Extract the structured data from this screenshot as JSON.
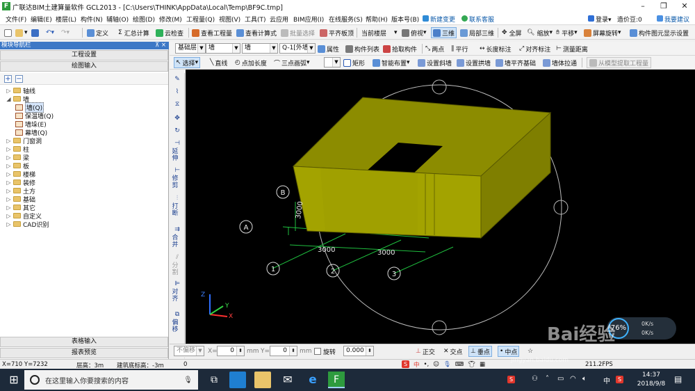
{
  "window": {
    "title": "广联达BIM土建算量软件 GCL2013 - [C:\\Users\\THINK\\AppData\\Local\\Temp\\BF9C.tmp]",
    "app_icon": "F",
    "btn_min": "–",
    "btn_max": "❐",
    "btn_close": "✕"
  },
  "menu": {
    "items": [
      "文件(F)",
      "编辑(E)",
      "楼层(L)",
      "构件(N)",
      "辅轴(O)",
      "绘图(D)",
      "修改(M)",
      "工程量(Q)",
      "视图(V)",
      "工具(T)",
      "云应用",
      "BIM应用(I)",
      "在线服务(S)",
      "帮助(H)",
      "版本号(B)",
      "新建变更",
      "联系客服"
    ],
    "login": "登录",
    "price_bean": "造价豆:0",
    "suggest": "我要建议"
  },
  "toolbar1": {
    "define": "定义",
    "sum_calc": "汇总计算",
    "cloud_check": "云检查",
    "view_quantity": "查看工程量",
    "view_formula": "查看计算式",
    "batch_select": "批量选择",
    "align_slab": "平齐板顶",
    "current_floor": "当前楼层",
    "top_view": "俯视",
    "three_d": "三维",
    "local_3d": "局部三维",
    "fullscreen": "全屏",
    "zoom": "缩放",
    "pan": "平移",
    "screen_rotate": "屏幕旋转",
    "element_display": "构件图元显示设置"
  },
  "toolbar2": {
    "floor_value": "基础层",
    "type_value": "墙",
    "subtype_value": "墙",
    "element_value": "Q-1[外墙",
    "properties": "属性",
    "element_list": "构件列表",
    "pick_element": "拾取构件",
    "two_points": "两点",
    "parallel": "平行",
    "length_dim": "长度标注",
    "aligned_dim": "对齐标注",
    "measure_distance": "测量距离"
  },
  "toolbar3": {
    "select": "选择",
    "line": "直线",
    "point_length": "点加长度",
    "three_point_arc": "三点画弧",
    "rectangle": "矩形",
    "smart_layout": "智能布置",
    "set_slope_wall": "设置斜墙",
    "set_arch_wall": "设置拱墙",
    "wall_align_base": "墙平齐基础",
    "wall_close": "墙体拉通",
    "extract_from_model": "从模型提取工程量"
  },
  "left_panel": {
    "header": "模块导航栏",
    "pin": "⊼ ×",
    "project_settings": "工程设置",
    "drawing_input": "绘图输入",
    "table_input": "表格输入",
    "report_preview": "报表预览",
    "tree": [
      {
        "label": "轴线",
        "level": 0,
        "expander": "▷",
        "kind": "folder"
      },
      {
        "label": "墙",
        "level": 0,
        "expander": "◢",
        "kind": "folder"
      },
      {
        "label": "墙(Q)",
        "level": 1,
        "expander": "",
        "kind": "leaf",
        "selected": true
      },
      {
        "label": "保温墙(Q)",
        "level": 1,
        "expander": "",
        "kind": "leaf"
      },
      {
        "label": "墙垛(E)",
        "level": 1,
        "expander": "",
        "kind": "leaf"
      },
      {
        "label": "幕墙(Q)",
        "level": 1,
        "expander": "",
        "kind": "leaf"
      },
      {
        "label": "门窗洞",
        "level": 0,
        "expander": "▷",
        "kind": "folder"
      },
      {
        "label": "柱",
        "level": 0,
        "expander": "▷",
        "kind": "folder"
      },
      {
        "label": "梁",
        "level": 0,
        "expander": "▷",
        "kind": "folder"
      },
      {
        "label": "板",
        "level": 0,
        "expander": "▷",
        "kind": "folder"
      },
      {
        "label": "楼梯",
        "level": 0,
        "expander": "▷",
        "kind": "folder"
      },
      {
        "label": "装修",
        "level": 0,
        "expander": "▷",
        "kind": "folder"
      },
      {
        "label": "土方",
        "level": 0,
        "expander": "▷",
        "kind": "folder"
      },
      {
        "label": "基础",
        "level": 0,
        "expander": "▷",
        "kind": "folder"
      },
      {
        "label": "其它",
        "level": 0,
        "expander": "▷",
        "kind": "folder"
      },
      {
        "label": "自定义",
        "level": 0,
        "expander": "▷",
        "kind": "folder"
      },
      {
        "label": "CAD识别",
        "level": 0,
        "expander": "▷",
        "kind": "folder"
      }
    ]
  },
  "side_tools": [
    "延伸",
    "修剪",
    "打断",
    "合并",
    "分割",
    "对齐",
    "偏移"
  ],
  "viewport": {
    "axis_labels": [
      "A",
      "B",
      "1",
      "2",
      "3"
    ],
    "dims": [
      "3000",
      "3000",
      "3000"
    ],
    "axis_triad": [
      "X",
      "Y",
      "Z"
    ],
    "colors": {
      "wall_top": "#8c8c00",
      "wall_front": "#a3a300",
      "wall_side": "#7a7a00",
      "axis": "#1fbf3f",
      "ring": "#bdbdbd"
    }
  },
  "widget": {
    "percent": "76%",
    "up": "0K/s",
    "down": "0K/s"
  },
  "coord_bar": {
    "mode": "不偏移",
    "x_label": "X=",
    "x_value": "0",
    "mm1": "mm",
    "y_label": "Y=",
    "y_value": "0",
    "mm2": "mm",
    "rotate": "旋转",
    "angle": "0.000",
    "ortho": "正交",
    "intersection": "交点",
    "perpendicular": "垂点",
    "midpoint": "中点"
  },
  "status": {
    "coords": "X=710  Y=7232",
    "floor_height": "层高：3m",
    "base_elev": "建筑底标高：-3m",
    "zero": "0",
    "right_value": "211.2FPS"
  },
  "ime": {
    "label": "中"
  },
  "taskbar": {
    "search_placeholder": "在这里输入你要搜索的内容",
    "clock_time": "14:37",
    "clock_date": "2018/9/8",
    "tray_lang": "中"
  },
  "watermark": {
    "text": "Bai经验",
    "sub": "jingyan.baidu.com"
  }
}
